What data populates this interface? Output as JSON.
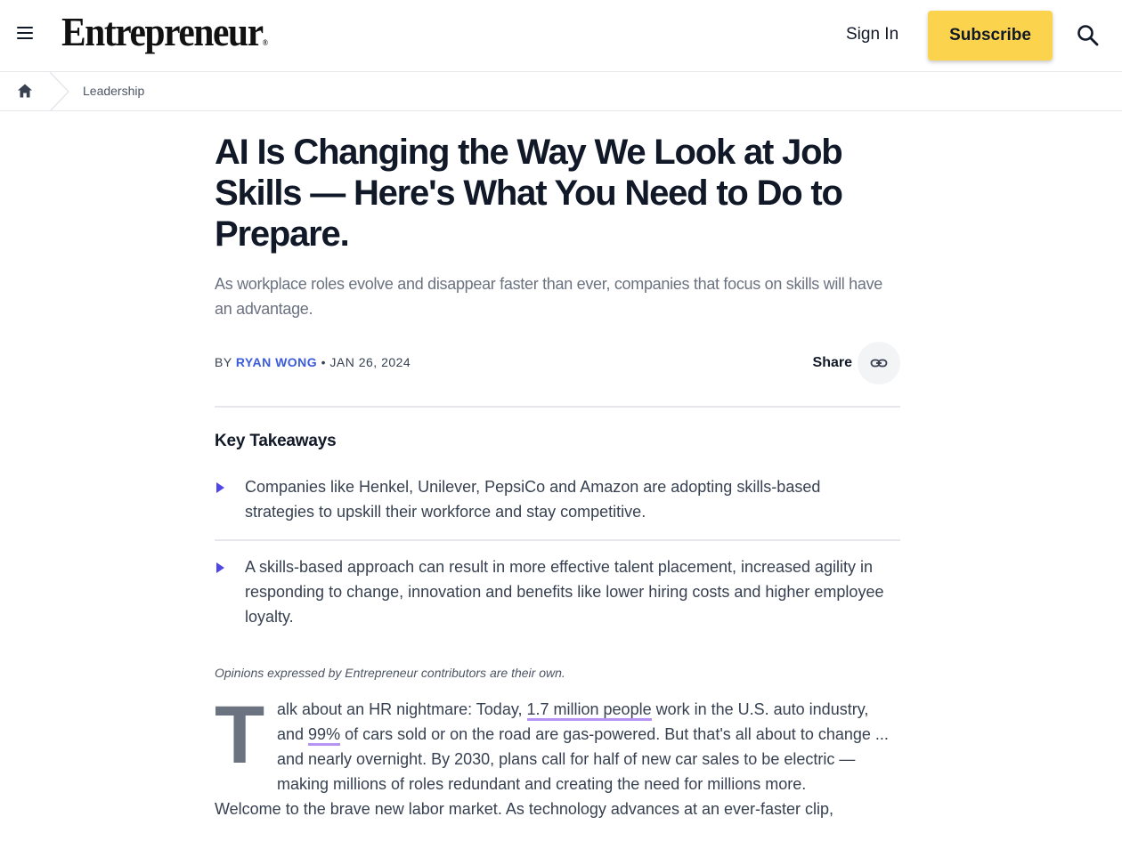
{
  "header": {
    "logo": "Entrepreneur",
    "logo_mark": "®",
    "sign_in": "Sign In",
    "subscribe": "Subscribe"
  },
  "breadcrumb": {
    "section": "Leadership"
  },
  "article": {
    "title": "AI Is Changing the Way We Look at Job Skills — Here's What You Need to Do to Prepare.",
    "dek": "As workplace roles evolve and disappear faster than ever, companies that focus on skills will have an advantage.",
    "byline_prefix": "BY",
    "author": "RYAN WONG",
    "separator": "•",
    "date": "JAN 26, 2024",
    "share_label": "Share",
    "key_takeaways_title": "Key Takeaways",
    "takeaways": [
      "Companies like Henkel, Unilever, PepsiCo and Amazon are adopting skills-based strategies to upskill their workforce and stay competitive.",
      "A skills-based approach can result in more effective talent placement, increased agility in responding to change, innovation and benefits like lower hiring costs and higher employee loyalty."
    ],
    "opinion_note": "Opinions expressed by Entrepreneur contributors are their own.",
    "body": {
      "dropcap": "T",
      "p1_a": "alk about an HR nightmare: Today, ",
      "p1_link1": "1.7 million people",
      "p1_b": " work in the U.S. auto industry, and ",
      "p1_link2": "99%",
      "p1_c": " of cars sold or on the road are gas-powered. But that's all about to change ... and nearly overnight. By 2030, plans call for half of new car sales to be electric — making millions of roles redundant and creating the need for millions more.",
      "p2": "Welcome to the brave new labor market. As technology advances at an ever-faster clip,"
    }
  },
  "colors": {
    "subscribe_bg": "#fcd34d",
    "author_link": "#3b5bdb",
    "takeaway_arrow": "#4f46e5",
    "link_underline": "#b794f4"
  },
  "icons": [
    "hamburger-menu-icon",
    "search-icon",
    "home-icon",
    "link-icon",
    "triangle-bullet-icon"
  ]
}
